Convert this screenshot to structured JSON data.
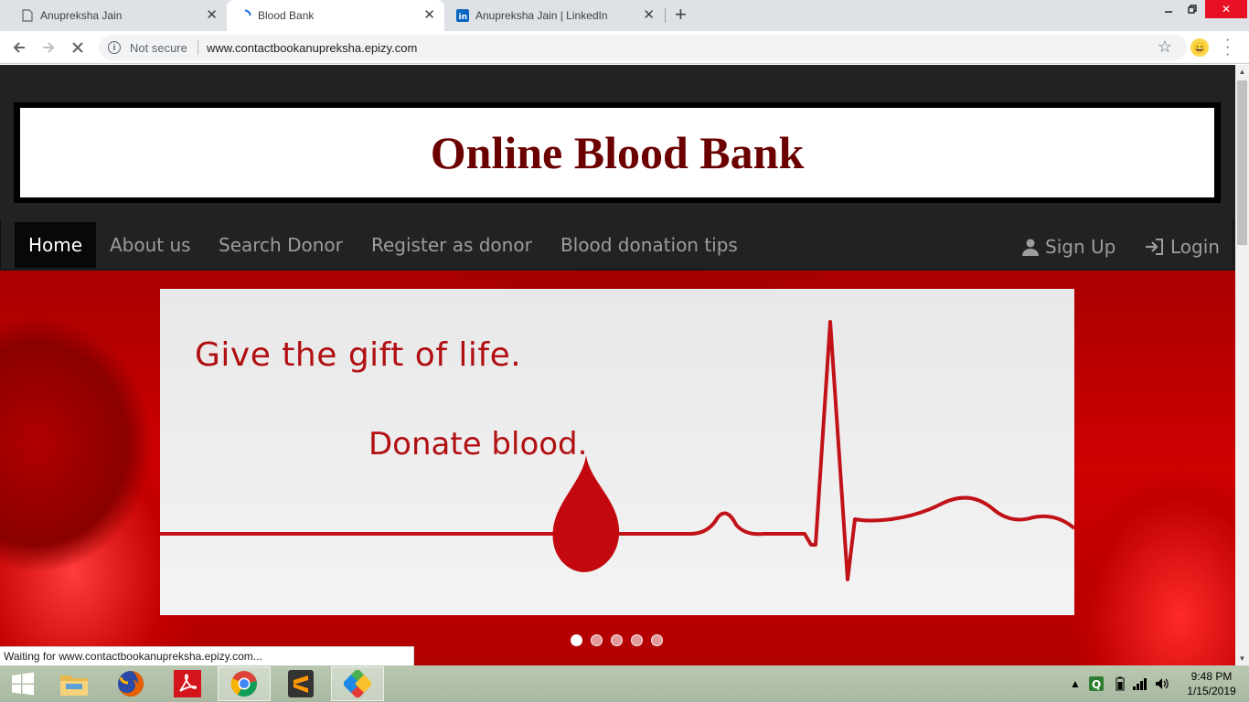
{
  "browser": {
    "tabs": [
      {
        "title": "Anupreksha Jain",
        "active": false
      },
      {
        "title": "Blood Bank",
        "active": true
      },
      {
        "title": "Anupreksha Jain | LinkedIn",
        "active": false
      }
    ],
    "security_label": "Not secure",
    "url": "www.contactbookanupreksha.epizy.com",
    "status_text": "Waiting for www.contactbookanupreksha.epizy.com..."
  },
  "site": {
    "title": "Online Blood Bank",
    "nav": {
      "home": "Home",
      "about": "About us",
      "search": "Search Donor",
      "register": "Register as donor",
      "tips": "Blood donation tips",
      "signup": "Sign Up",
      "login": "Login"
    },
    "carousel": {
      "line1": "Give the gift of life.",
      "line2": "Donate blood.",
      "slide_count": 5,
      "active_index": 0
    }
  },
  "taskbar": {
    "time": "9:48 PM",
    "date": "1/15/2019"
  },
  "colors": {
    "banner_title": "#6b0000",
    "slide_text": "#b10f12",
    "navbar": "#222222"
  }
}
